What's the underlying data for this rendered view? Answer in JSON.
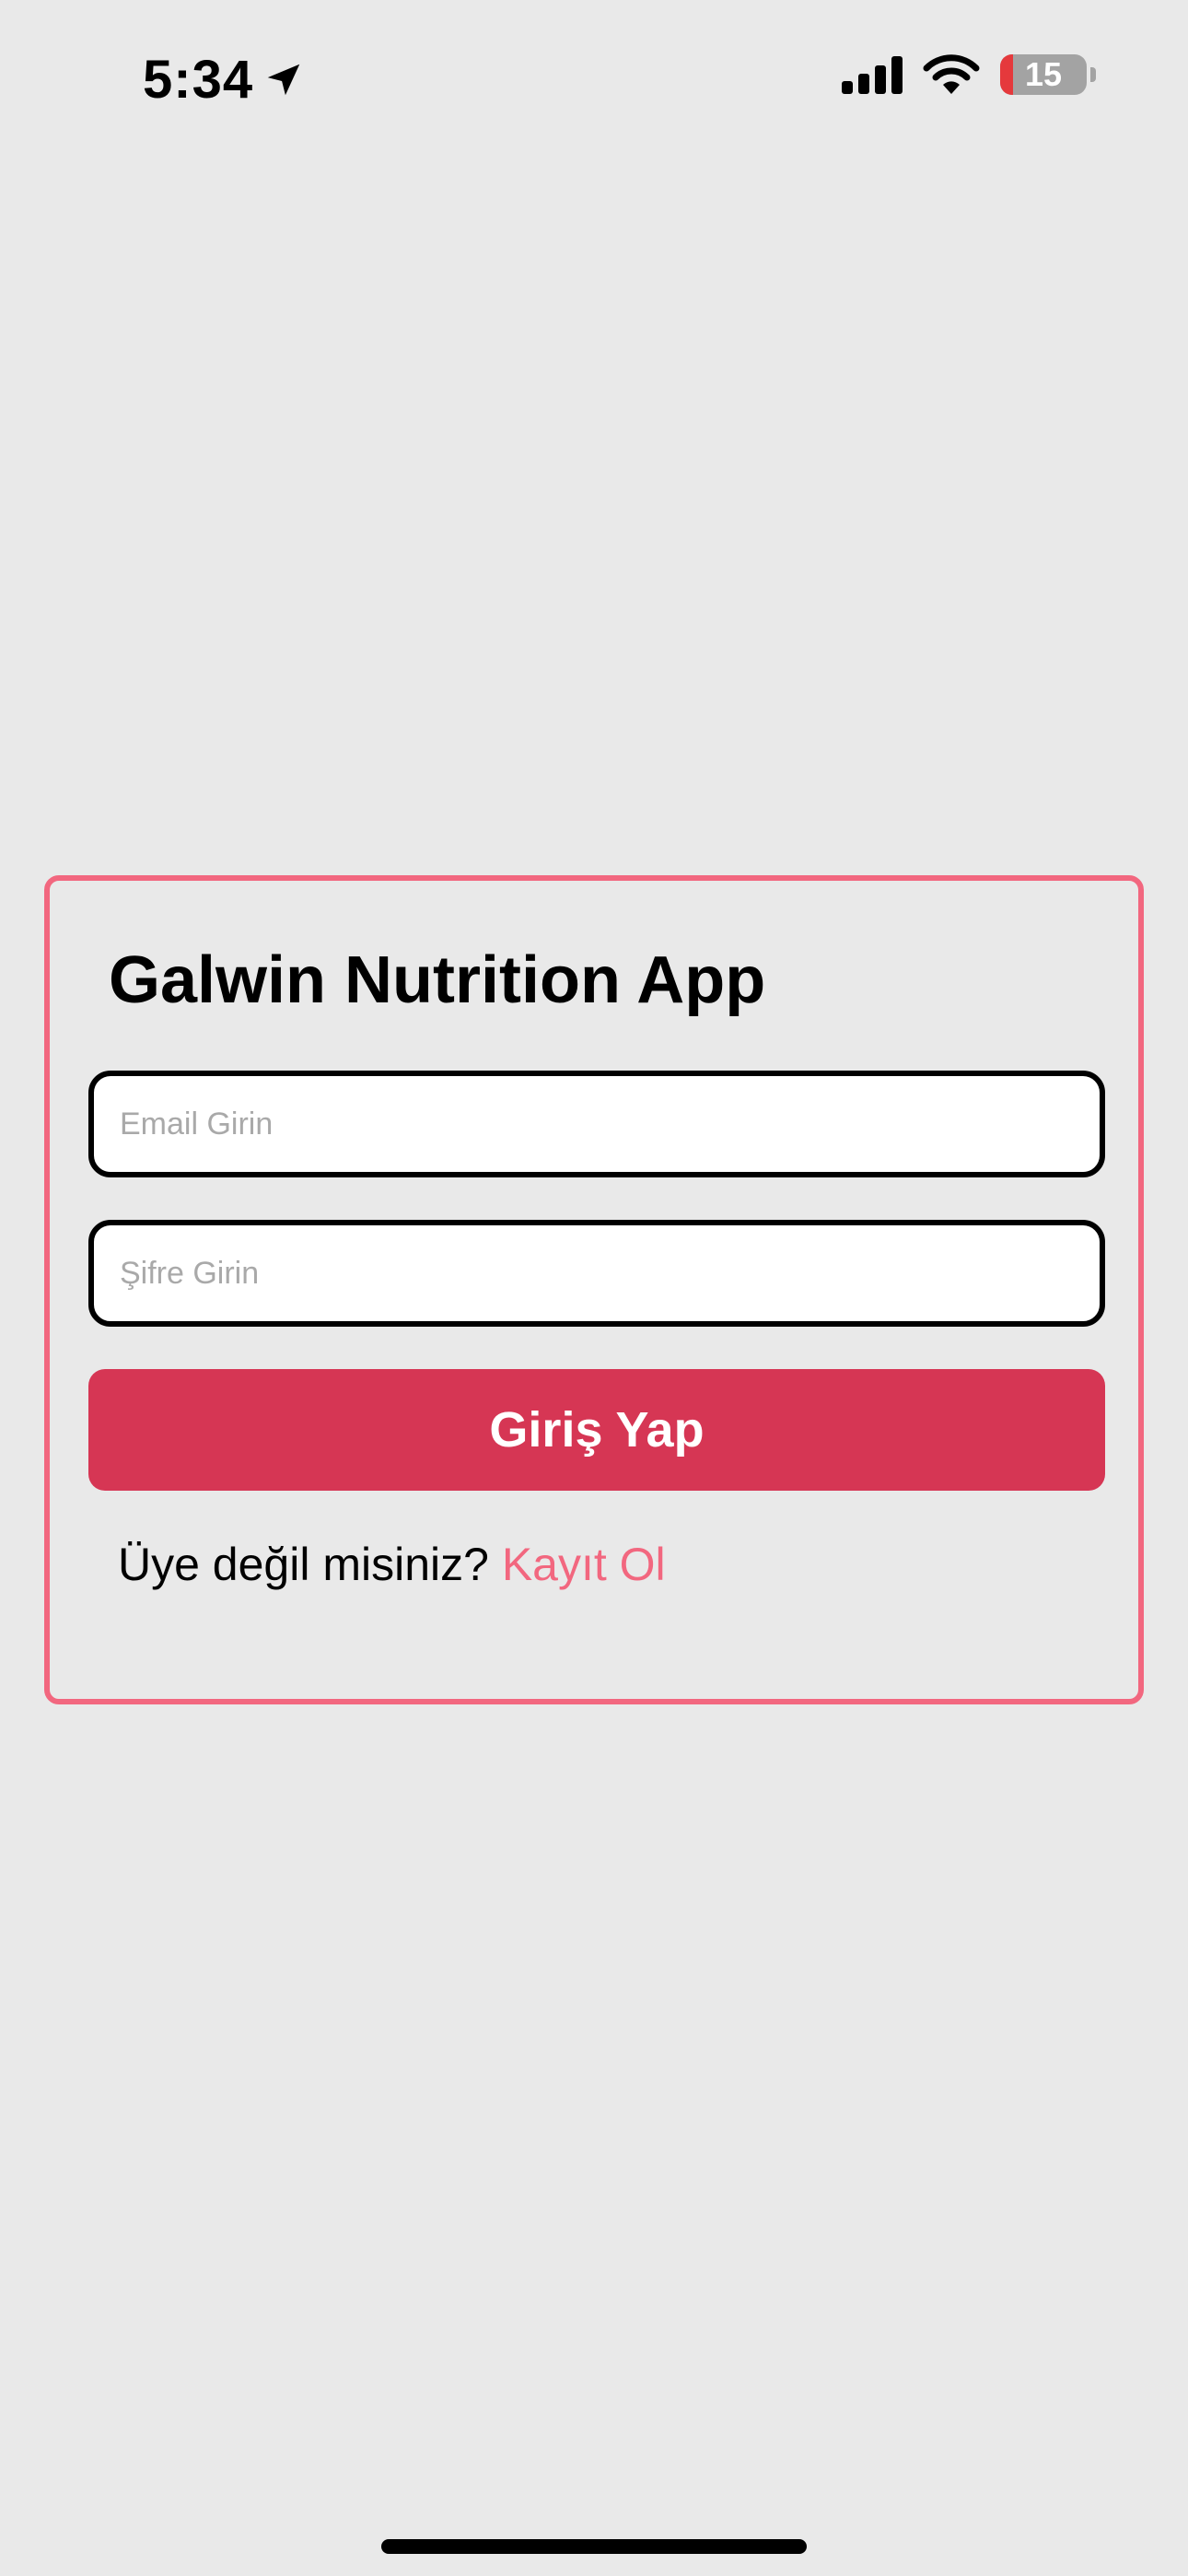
{
  "status_bar": {
    "time": "5:34",
    "battery_level": "15",
    "battery_fraction": 0.15,
    "icons": [
      "location-arrow-icon",
      "cellular-signal-icon",
      "wifi-icon",
      "battery-icon"
    ]
  },
  "login": {
    "title": "Galwin Nutrition App",
    "email_placeholder": "Email Girin",
    "email_value": "",
    "password_placeholder": "Şifre Girin",
    "password_value": "",
    "submit_label": "Giriş Yap",
    "signup_prompt": "Üye değil misiniz?",
    "signup_link": "Kayıt Ol"
  },
  "colors": {
    "background": "#e9e9e9",
    "card_border": "#f2677f",
    "primary_button": "#d63654",
    "link": "#f2677f",
    "battery_low": "#e5393c"
  }
}
